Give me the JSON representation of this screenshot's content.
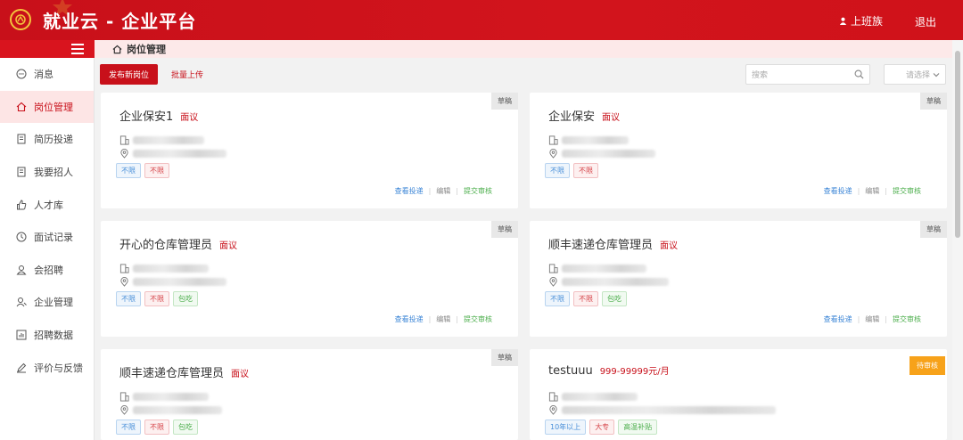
{
  "header": {
    "app_title": "就业云 - 企业平台",
    "user_name": "上班族",
    "logout_label": "退出"
  },
  "breadcrumb": {
    "current": "岗位管理"
  },
  "sidebar": {
    "items": [
      {
        "label": "消息",
        "icon": "message-icon",
        "active": false
      },
      {
        "label": "岗位管理",
        "icon": "home-icon",
        "active": true
      },
      {
        "label": "简历投递",
        "icon": "document-icon",
        "active": false
      },
      {
        "label": "我要招人",
        "icon": "document-icon",
        "active": false
      },
      {
        "label": "人才库",
        "icon": "thumbs-up-icon",
        "active": false
      },
      {
        "label": "面试记录",
        "icon": "clock-icon",
        "active": false
      },
      {
        "label": "会招聘",
        "icon": "people-icon",
        "active": false
      },
      {
        "label": "企业管理",
        "icon": "user-icon",
        "active": false
      },
      {
        "label": "招聘数据",
        "icon": "chart-icon",
        "active": false
      },
      {
        "label": "评价与反馈",
        "icon": "edit-icon",
        "active": false
      }
    ]
  },
  "toolbar": {
    "publish_label": "发布新岗位",
    "batch_upload_label": "批量上传",
    "search_placeholder": "搜索",
    "select_placeholder": "请选择"
  },
  "cards": [
    {
      "title": "企业保安1",
      "salary": "面议",
      "status": "草稿",
      "tags": [
        {
          "text": "不限",
          "color": "blue"
        },
        {
          "text": "不限",
          "color": "red"
        }
      ]
    },
    {
      "title": "企业保安",
      "salary": "面议",
      "status": "草稿",
      "tags": [
        {
          "text": "不限",
          "color": "blue"
        },
        {
          "text": "不限",
          "color": "red"
        }
      ]
    },
    {
      "title": "开心的仓库管理员",
      "salary": "面议",
      "status": "草稿",
      "tags": [
        {
          "text": "不限",
          "color": "blue"
        },
        {
          "text": "不限",
          "color": "red"
        },
        {
          "text": "包吃",
          "color": "green"
        }
      ]
    },
    {
      "title": "顺丰速递仓库管理员",
      "salary": "面议",
      "status": "草稿",
      "tags": [
        {
          "text": "不限",
          "color": "blue"
        },
        {
          "text": "不限",
          "color": "red"
        },
        {
          "text": "包吃",
          "color": "green"
        }
      ]
    },
    {
      "title": "顺丰速递仓库管理员",
      "salary": "面议",
      "status": "草稿",
      "tags": [
        {
          "text": "不限",
          "color": "blue"
        },
        {
          "text": "不限",
          "color": "red"
        },
        {
          "text": "包吃",
          "color": "green"
        }
      ]
    },
    {
      "title": "testuuu",
      "salary": "999-99999元/月",
      "status": "待审核",
      "tags": [
        {
          "text": "10年以上",
          "color": "blue"
        },
        {
          "text": "大专",
          "color": "red"
        },
        {
          "text": "高温补贴",
          "color": "green"
        }
      ]
    }
  ],
  "card_actions": {
    "view_label": "查看投递",
    "edit_label": "编辑",
    "submit_label": "提交审核"
  },
  "colors": {
    "brand": "#c8101a",
    "pending": "#f7a21a"
  }
}
